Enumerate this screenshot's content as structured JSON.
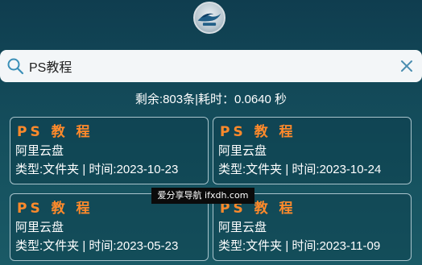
{
  "search": {
    "value": "PS教程",
    "placeholder": ""
  },
  "stats": {
    "text": "剩余:803条|耗时：0.0640 秒"
  },
  "results": [
    {
      "title": "PS 教 程",
      "source": "阿里云盘",
      "meta": "类型:文件夹 | 时间:2023-10-23"
    },
    {
      "title": "PS 教 程",
      "source": "阿里云盘",
      "meta": "类型:文件夹 | 时间:2023-10-24"
    },
    {
      "title": "PS 教 程",
      "source": "阿里云盘",
      "meta": "类型:文件夹 | 时间:2023-05-23"
    },
    {
      "title": "PS 教 程",
      "source": "阿里云盘",
      "meta": "类型:文件夹 | 时间:2023-11-09"
    }
  ],
  "watermark": {
    "text": "爱分享导航 ifxdh.com"
  },
  "colors": {
    "background": "#15505e",
    "title_accent": "#ff8a2b",
    "card_border": "#a9c4cc",
    "search_bg": "#f3f6f8",
    "icon": "#3a8fb7"
  },
  "icons": {
    "logo": "site-logo",
    "search": "search-icon",
    "clear": "close-icon"
  }
}
